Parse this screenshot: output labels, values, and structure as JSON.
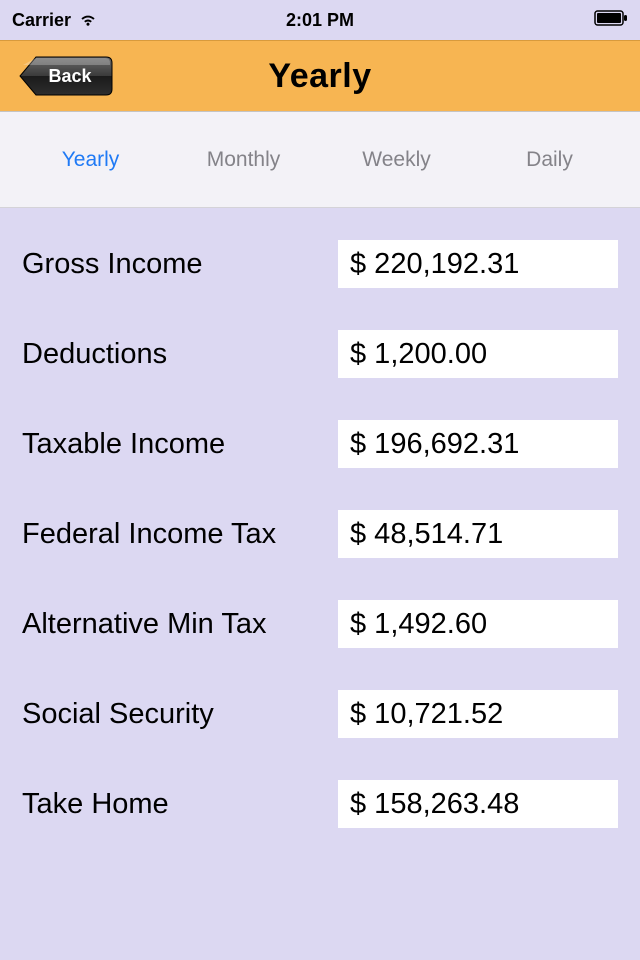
{
  "status": {
    "carrier": "Carrier",
    "time": "2:01 PM"
  },
  "nav": {
    "back_label": "Back",
    "title": "Yearly"
  },
  "tabs": [
    {
      "label": "Yearly",
      "active": true
    },
    {
      "label": "Monthly",
      "active": false
    },
    {
      "label": "Weekly",
      "active": false
    },
    {
      "label": "Daily",
      "active": false
    }
  ],
  "rows": [
    {
      "label": "Gross Income",
      "value": "$ 220,192.31"
    },
    {
      "label": "Deductions",
      "value": "$ 1,200.00"
    },
    {
      "label": "Taxable Income",
      "value": "$ 196,692.31"
    },
    {
      "label": "Federal Income Tax",
      "value": "$ 48,514.71"
    },
    {
      "label": "Alternative Min Tax",
      "value": "$ 1,492.60"
    },
    {
      "label": "Social Security",
      "value": "$ 10,721.52"
    },
    {
      "label": "Take Home",
      "value": "$ 158,263.48"
    }
  ]
}
